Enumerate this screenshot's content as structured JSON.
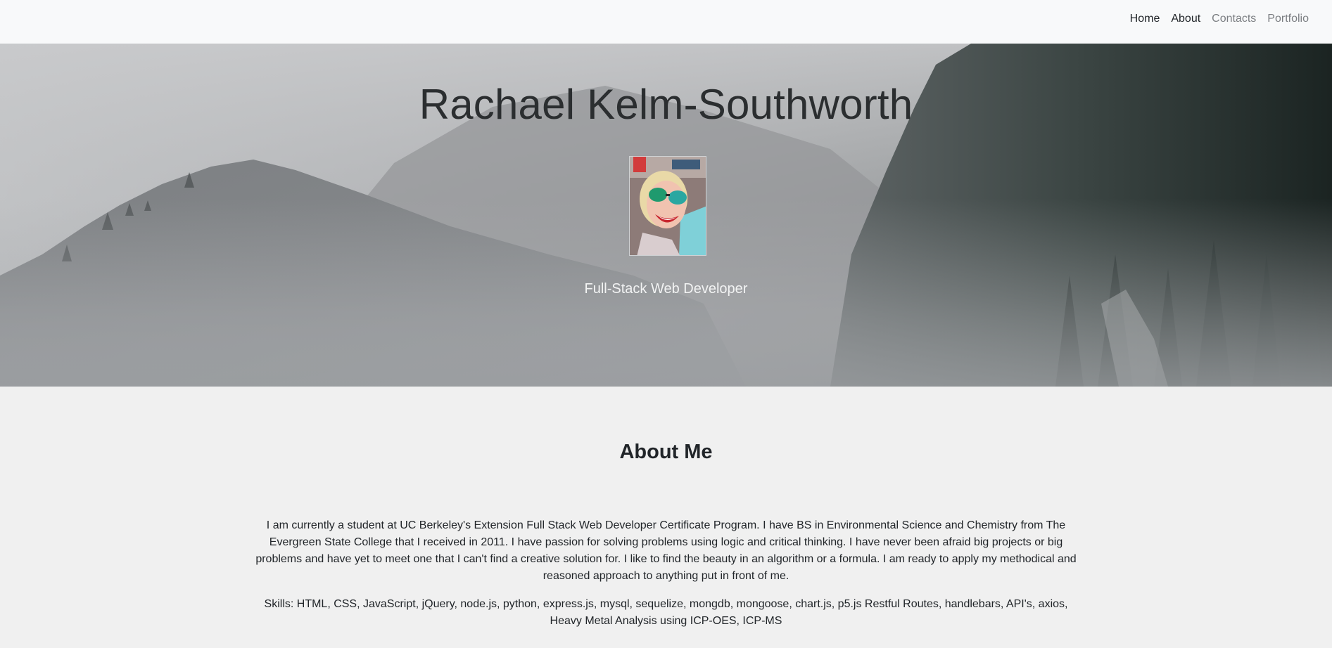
{
  "navbar": {
    "items": [
      {
        "label": "Home",
        "state": "active"
      },
      {
        "label": "About",
        "state": "active"
      },
      {
        "label": "Contacts",
        "state": "muted"
      },
      {
        "label": "Portfolio",
        "state": "muted"
      }
    ]
  },
  "hero": {
    "title": "Rachael Kelm-Southworth",
    "subtitle": "Full-Stack Web Developer"
  },
  "about": {
    "heading": "About Me",
    "bio": "I am currently a student at UC Berkeley's Extension Full Stack Web Developer Certificate Program. I have BS in Environmental Science and Chemistry from The Evergreen State College that I received in 2011. I have passion for solving problems using logic and critical thinking. I have never been afraid big projects or big problems and have yet to meet one that I can't find a creative solution for. I like to find the beauty in an algorithm or a formula. I am ready to apply my methodical and reasoned approach to anything put in front of me.",
    "skills": "Skills: HTML, CSS, JavaScript, jQuery, node.js, python, express.js, mysql, sequelize, mongdb, mongoose, chart.js, p5.js Restful Routes, handlebars, API's, axios, Heavy Metal Analysis using ICP-OES, ICP-MS"
  },
  "colors": {
    "navbar_bg": "#f8f9fa",
    "page_bg": "#f0f0f0",
    "nav_active": "#212529",
    "nav_muted": "#7b7e82"
  }
}
